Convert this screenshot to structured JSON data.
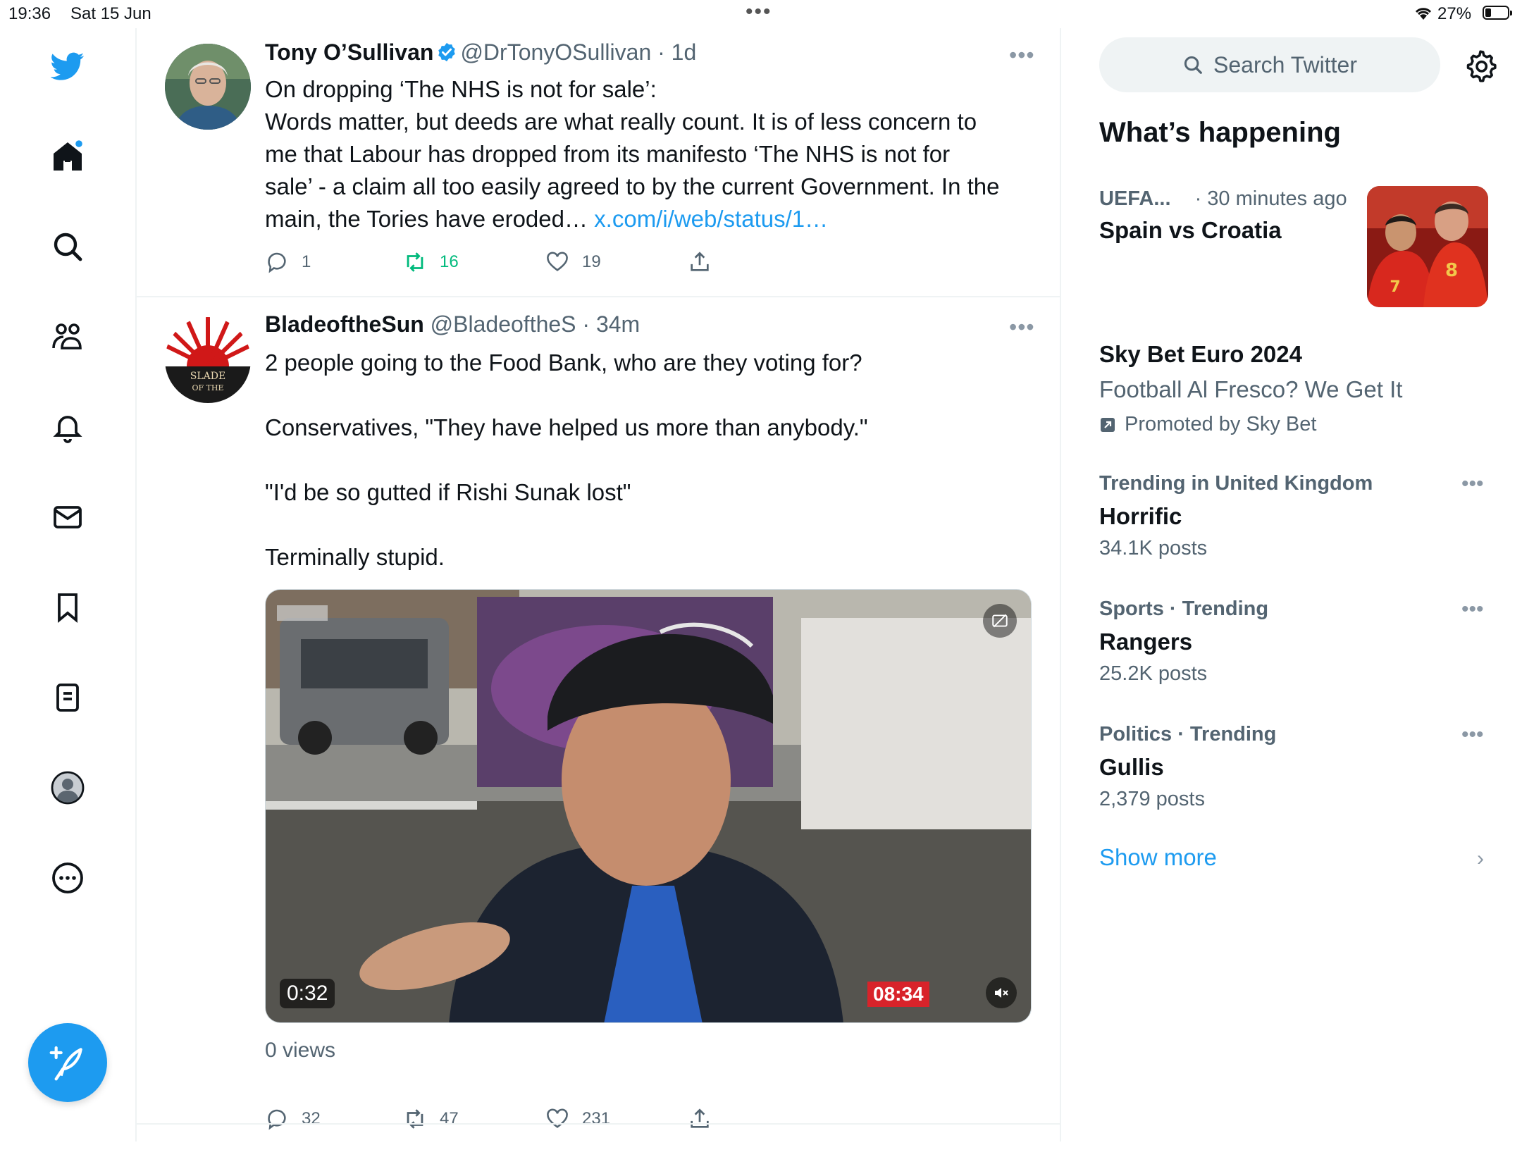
{
  "status_bar": {
    "time": "19:36",
    "date": "Sat 15 Jun",
    "battery_percent": "27%"
  },
  "nav": {
    "icons": [
      "twitter-bird-icon",
      "home-icon",
      "search-icon",
      "communities-icon",
      "notifications-icon",
      "messages-icon",
      "bookmarks-icon",
      "lists-icon",
      "profile-icon",
      "more-icon"
    ],
    "compose_icon": "compose-tweet-icon",
    "brand_color": "#1d9bf0"
  },
  "feed": {
    "tweets": [
      {
        "name": "Tony O’Sullivan",
        "verified": true,
        "handle": "@DrTonyOSullivan",
        "time": "· 1d",
        "lines": [
          "On dropping ‘The NHS is not for sale’:",
          "Words matter, but deeds are what really count. It is of less concern to",
          "me that Labour has dropped from its manifesto ‘The NHS is not for",
          "sale’ - a claim all too easily agreed to by the current Government. In the",
          "main, the Tories have eroded…"
        ],
        "link": "x.com/i/web/status/1…",
        "replies": "1",
        "retweets": "16",
        "likes": "19"
      },
      {
        "name": "BladeoftheSun",
        "handle": "@BladeoftheS",
        "time": "· 34m",
        "lines": [
          "2 people going to the Food Bank, who are they voting for?",
          "Conservatives, \"They have helped us more than anybody.\"",
          "\"I'd be so gutted if Rishi Sunak lost\"",
          "Terminally stupid."
        ],
        "video_duration": "0:32",
        "video_clock": "08:34",
        "views": "0 views",
        "replies": "32",
        "retweets": "47",
        "likes": "231"
      }
    ]
  },
  "sidebar": {
    "search_placeholder": "Search Twitter",
    "section_title": "What’s happening",
    "event": {
      "category": "UEFA...",
      "time": "· 30 minutes ago",
      "title": "Spain vs Croatia"
    },
    "promo": {
      "title": "Sky Bet Euro 2024",
      "subtitle": "Football Al Fresco? We Get It",
      "promoted_by": "Promoted by Sky Bet"
    },
    "trends": [
      {
        "meta": "Trending in United Kingdom",
        "title": "Horrific",
        "count": "34.1K posts"
      },
      {
        "meta": "Sports · Trending",
        "title": "Rangers",
        "count": "25.2K posts"
      },
      {
        "meta": "Politics · Trending",
        "title": "Gullis",
        "count": "2,379 posts"
      }
    ],
    "show_more": "Show more"
  }
}
